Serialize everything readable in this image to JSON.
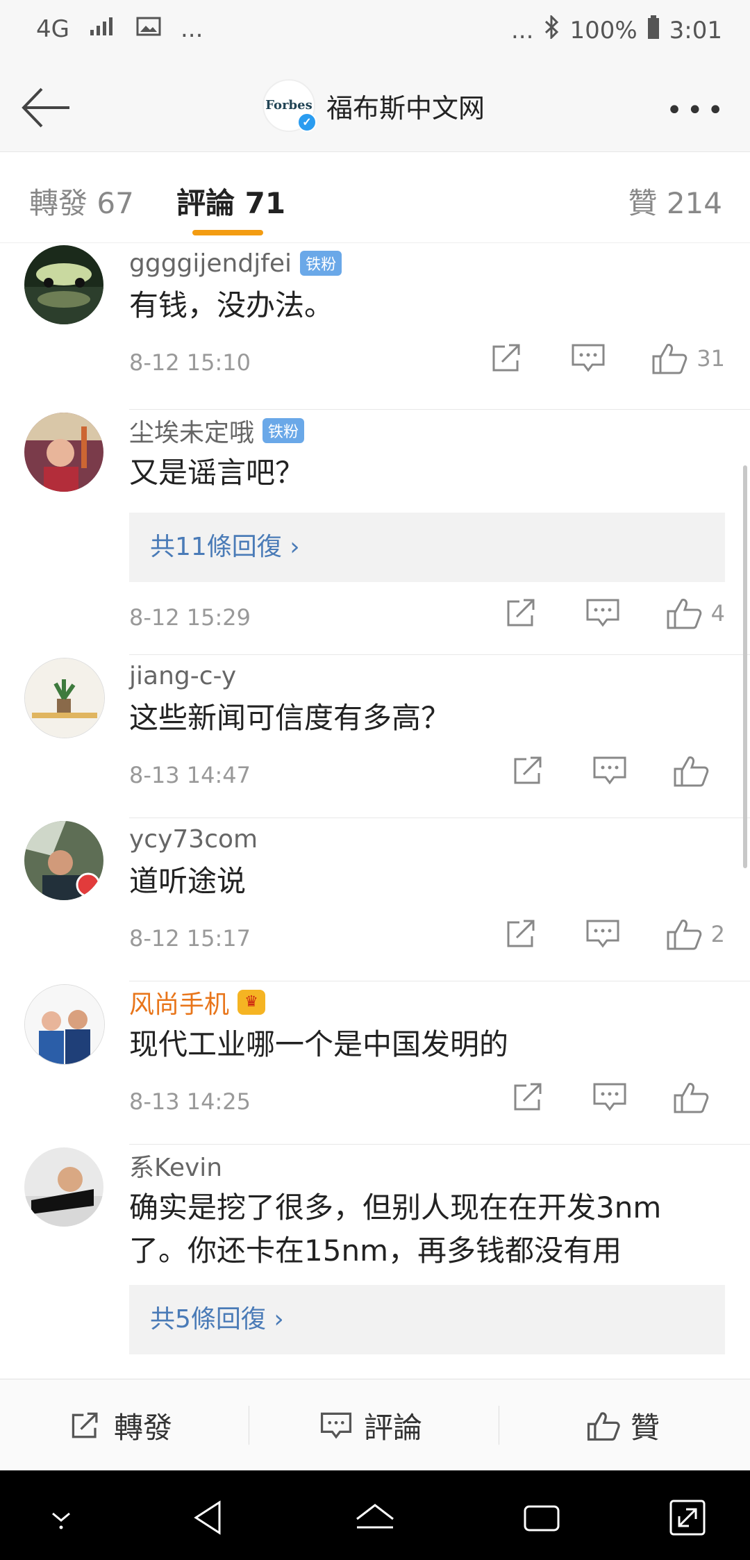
{
  "status": {
    "net": "4G",
    "battery": "100%",
    "time": "3:01",
    "dots": "...",
    "dots2": "..."
  },
  "nav": {
    "title": "福布斯中文网",
    "logo_text": "Forbes"
  },
  "tabs": {
    "repost": "轉發 67",
    "comment": "評論 71",
    "like": "贊 214"
  },
  "comments": [
    {
      "user": "ggggijendjfei",
      "badge": "铁粉",
      "text": "有钱，没办法。",
      "time": "8-12 15:10",
      "likes": "31"
    },
    {
      "user": "尘埃未定哦",
      "badge": "铁粉",
      "text": "又是谣言吧？",
      "reply": "共11條回復 ›",
      "time": "8-12 15:29",
      "likes": "4"
    },
    {
      "user": "jiang-c-y",
      "text": "这些新闻可信度有多高？",
      "time": "8-13 14:47",
      "likes": ""
    },
    {
      "user": "ycy73com",
      "text": "道听途说",
      "time": "8-12 15:17",
      "likes": "2"
    },
    {
      "user": "风尚手机",
      "text": "现代工业哪一个是中国发明的",
      "time": "8-13 14:25",
      "likes": ""
    },
    {
      "user": "系Kevin",
      "text": "确实是挖了很多，但别人现在在开发3nm了。你还卡在15nm，再多钱都没有用",
      "reply": "共5條回復 ›"
    }
  ],
  "bottom": {
    "repost": "轉發",
    "comment": "評論",
    "like": "贊"
  }
}
